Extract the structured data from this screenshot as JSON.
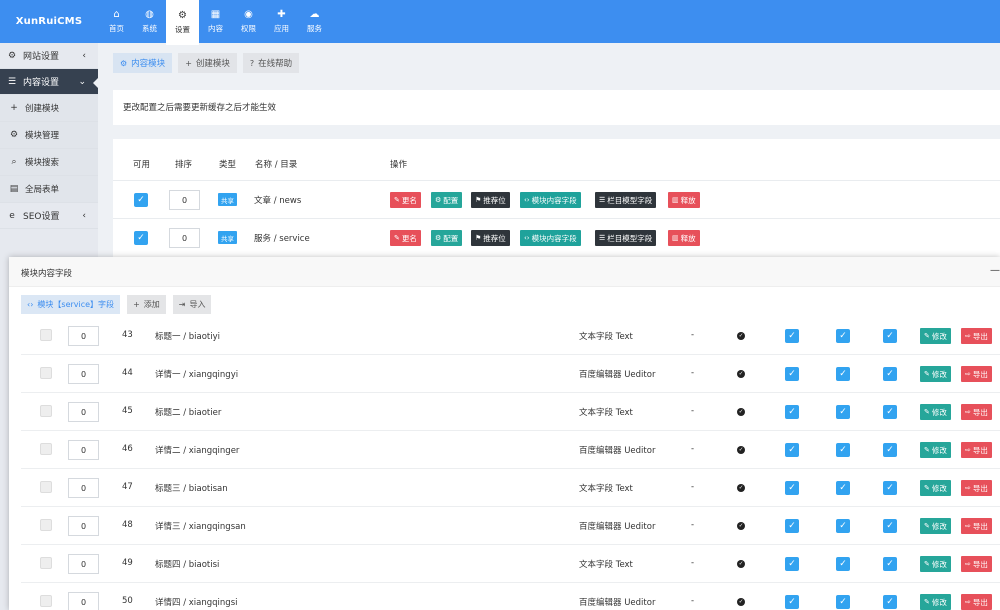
{
  "logo": "XunRuiCMS",
  "nav": [
    {
      "label": "首页",
      "icon": "home-icon"
    },
    {
      "label": "系统",
      "icon": "globe-icon"
    },
    {
      "label": "设置",
      "icon": "cogs-icon"
    },
    {
      "label": "内容",
      "icon": "grid-icon"
    },
    {
      "label": "权限",
      "icon": "user-icon"
    },
    {
      "label": "应用",
      "icon": "puzzle-icon"
    },
    {
      "label": "服务",
      "icon": "cloud-icon"
    }
  ],
  "nav_active_index": 2,
  "sidebar": [
    {
      "label": "网站设置",
      "icon": "gear-icon",
      "type": "head"
    },
    {
      "label": "内容设置",
      "icon": "list-icon",
      "type": "head-active"
    },
    {
      "label": "创建模块",
      "icon": "plus-icon",
      "type": "sub"
    },
    {
      "label": "模块管理",
      "icon": "cogs-icon",
      "type": "sub"
    },
    {
      "label": "模块搜索",
      "icon": "search-icon",
      "type": "sub"
    },
    {
      "label": "全局表单",
      "icon": "table-icon",
      "type": "sub"
    },
    {
      "label": "SEO设置",
      "icon": "ie-icon",
      "type": "head"
    }
  ],
  "tabs": [
    {
      "label": "内容模块",
      "icon": "cogs-icon",
      "active": true
    },
    {
      "label": "创建模块",
      "icon": "plus-icon",
      "active": false
    },
    {
      "label": "在线帮助",
      "icon": "question-icon",
      "active": false
    }
  ],
  "notice": "更改配置之后需要更新缓存之后才能生效",
  "module_table": {
    "headers": [
      "可用",
      "排序",
      "类型",
      "名称 / 目录",
      "操作"
    ],
    "rows": [
      {
        "enabled": true,
        "order": "0",
        "type": "共享",
        "name": "文章 / news"
      },
      {
        "enabled": true,
        "order": "0",
        "type": "共享",
        "name": "服务 / service"
      }
    ],
    "actions": [
      {
        "label": "更名",
        "color": "#e7505a",
        "icon": "edit-icon"
      },
      {
        "label": "配置",
        "color": "#26a69a",
        "icon": "gear-icon"
      },
      {
        "label": "推荐位",
        "color": "#2f353b",
        "icon": "flag-icon"
      },
      {
        "label": "模块内容字段",
        "color": "#1fa29b",
        "icon": "code-icon"
      },
      {
        "label": "栏目模型字段",
        "color": "#2f353b",
        "icon": "list-icon"
      },
      {
        "label": "释放",
        "color": "#e7505a",
        "icon": "trash-icon"
      }
    ]
  },
  "modal": {
    "title": "模块内容字段",
    "close": "—",
    "tabs": [
      {
        "label": "模块【service】字段",
        "icon": "code-icon",
        "active": true
      },
      {
        "label": "添加",
        "icon": "plus-icon",
        "active": false
      },
      {
        "label": "导入",
        "icon": "import-icon",
        "active": false
      }
    ],
    "edit_label": "修改",
    "export_label": "导出",
    "rows": [
      {
        "order": "0",
        "id": "43",
        "name": "标题一 / biaotiyi",
        "fieldtype": "文本字段 Text",
        "dash": "-"
      },
      {
        "order": "0",
        "id": "44",
        "name": "详情一 / xiangqingyi",
        "fieldtype": "百度编辑器 Ueditor",
        "dash": "-"
      },
      {
        "order": "0",
        "id": "45",
        "name": "标题二 / biaotier",
        "fieldtype": "文本字段 Text",
        "dash": "-"
      },
      {
        "order": "0",
        "id": "46",
        "name": "详情二 / xiangqinger",
        "fieldtype": "百度编辑器 Ueditor",
        "dash": "-"
      },
      {
        "order": "0",
        "id": "47",
        "name": "标题三 / biaotisan",
        "fieldtype": "文本字段 Text",
        "dash": "-"
      },
      {
        "order": "0",
        "id": "48",
        "name": "详情三 / xiangqingsan",
        "fieldtype": "百度编辑器 Ueditor",
        "dash": "-"
      },
      {
        "order": "0",
        "id": "49",
        "name": "标题四 / biaotisi",
        "fieldtype": "文本字段 Text",
        "dash": "-"
      },
      {
        "order": "0",
        "id": "50",
        "name": "详情四 / xiangqingsi",
        "fieldtype": "百度编辑器 Ueditor",
        "dash": "-"
      }
    ]
  }
}
